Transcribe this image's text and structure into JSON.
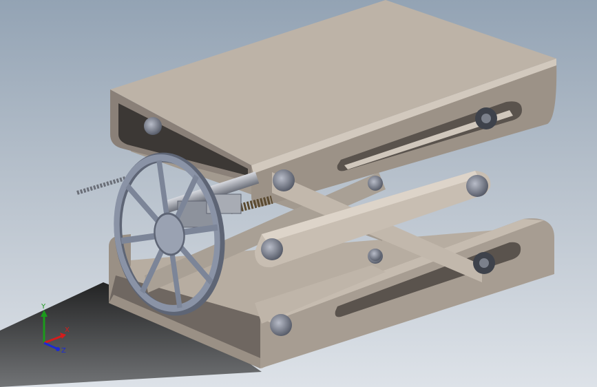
{
  "triad": {
    "y_label": "Y",
    "x_label": "X",
    "z_label": "Z"
  },
  "colors": {
    "background_top": "#93a3b4",
    "background_bottom": "#dde2e8",
    "plate_top": "#bdb3a7",
    "plate_front": "#8a8078",
    "plate_side": "#6f6761",
    "scissor_arm": "#c2b8ac",
    "handwheel": "#7c8598",
    "axis_x": "#d41c1c",
    "axis_y": "#1c9a1c",
    "axis_z": "#1c2ad4"
  }
}
